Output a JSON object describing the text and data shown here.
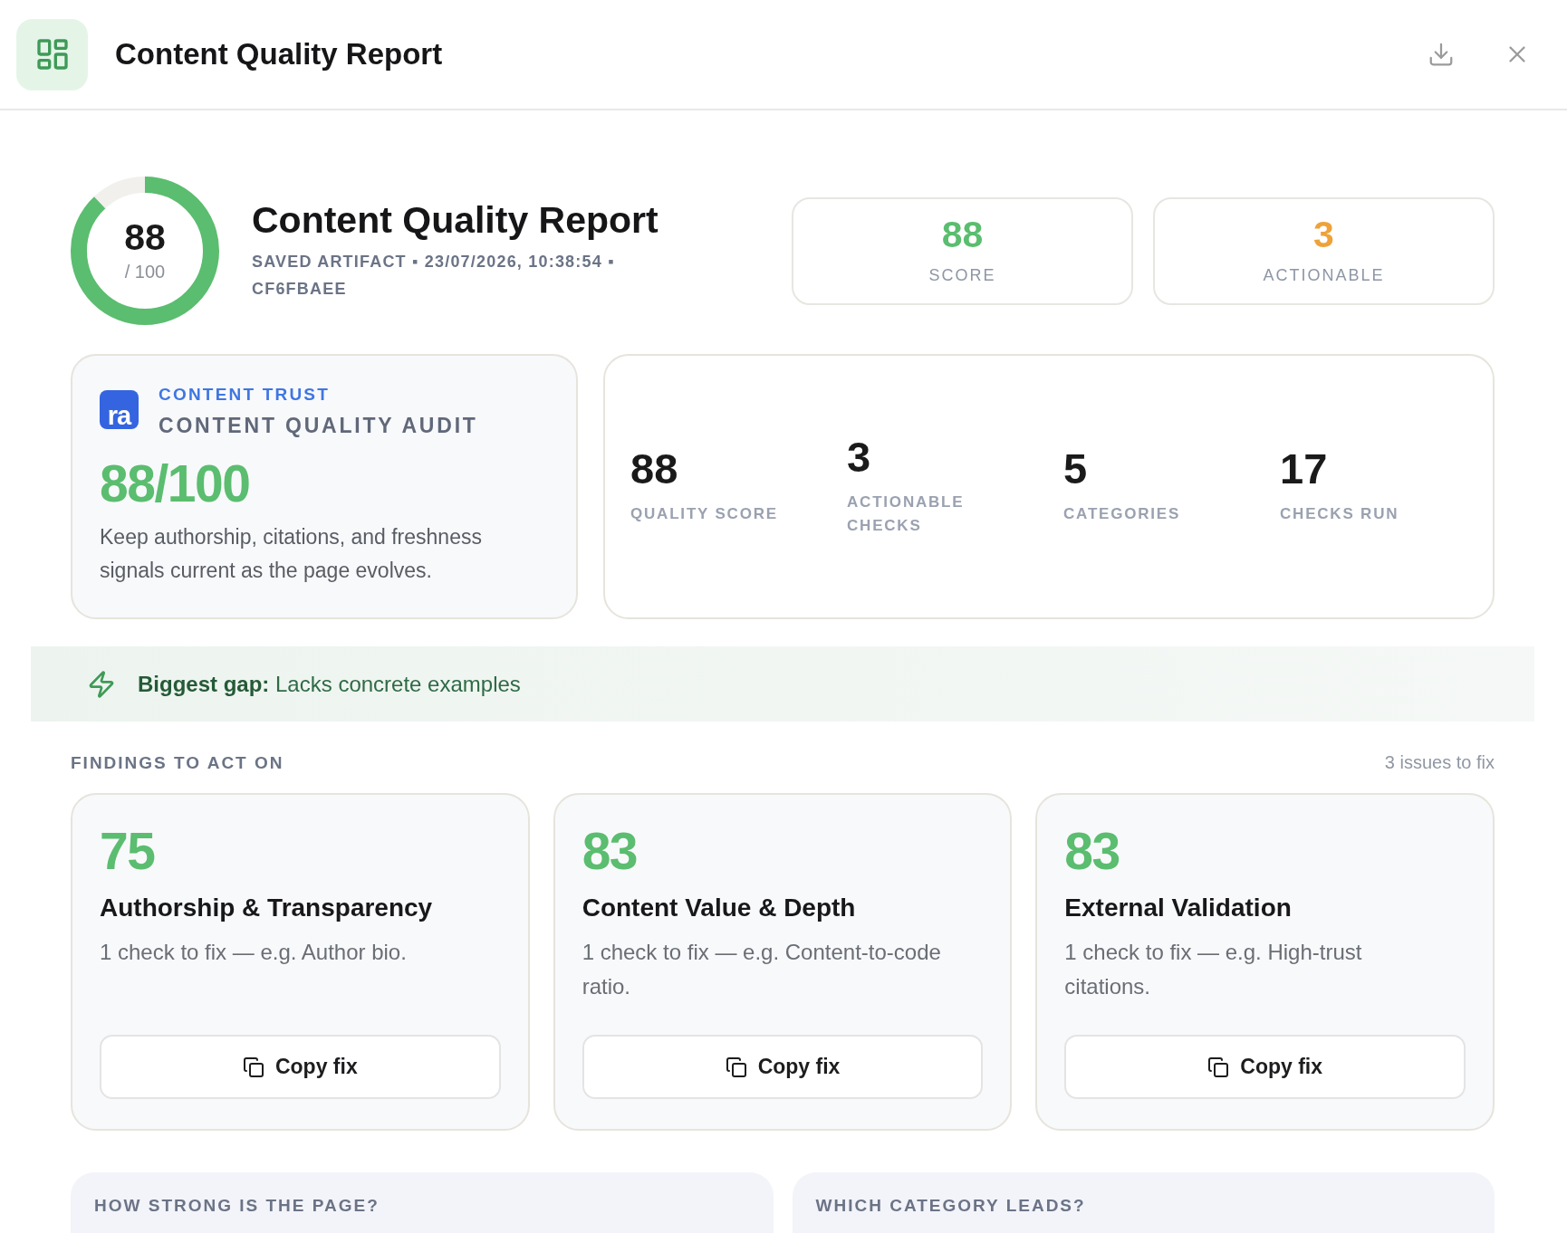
{
  "header": {
    "title": "Content Quality Report"
  },
  "summary": {
    "score": "88",
    "score_max": "/ 100",
    "level": 0.88,
    "title": "Content Quality Report",
    "meta": "SAVED ARTIFACT ▪ 23/07/2026, 10:38:54 ▪ CF6FBAEE"
  },
  "kpis": [
    {
      "value": "88",
      "label": "SCORE",
      "color": "#5bbd6f"
    },
    {
      "value": "3",
      "label": "ACTIONABLE",
      "color": "#eea23a"
    }
  ],
  "audit": {
    "logo": "ra",
    "eyebrow": "CONTENT TRUST",
    "title": "CONTENT QUALITY AUDIT",
    "score": "88/100",
    "description": "Keep authorship, citations, and freshness signals current as the page evolves."
  },
  "stats": [
    {
      "value": "88",
      "label": "QUALITY SCORE"
    },
    {
      "value": "3",
      "label": "ACTIONABLE CHECKS"
    },
    {
      "value": "5",
      "label": "CATEGORIES"
    },
    {
      "value": "17",
      "label": "CHECKS RUN"
    }
  ],
  "banner": {
    "text": "**Biggest gap:** Lacks concrete examples"
  },
  "findings": {
    "title": "FINDINGS TO ACT ON",
    "count": "3 issues to fix",
    "items": [
      {
        "score": "75",
        "title": "Authorship & Transparency",
        "description": "1 check to fix — e.g. Author bio.",
        "button": "Copy fix"
      },
      {
        "score": "83",
        "title": "Content Value & Depth",
        "description": "1 check to fix — e.g. Content-to-code ratio.",
        "button": "Copy fix"
      },
      {
        "score": "83",
        "title": "External Validation",
        "description": "1 check to fix — e.g. High-trust citations.",
        "button": "Copy fix"
      }
    ]
  },
  "panels": [
    {
      "title": "HOW STRONG IS THE PAGE?"
    },
    {
      "title": "WHICH CATEGORY LEADS?"
    }
  ]
}
